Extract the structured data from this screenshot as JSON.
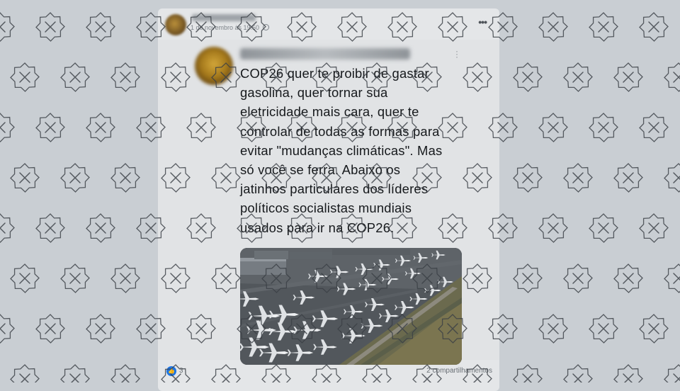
{
  "post": {
    "timestamp": "1 de novembro às 19:50",
    "more_icon": "more-horizontal-icon",
    "privacy_icon": "globe-icon"
  },
  "tweet": {
    "text_lines": [
      "COP26 quer te proibir de gastar",
      "gasolina, quer tornar sua",
      "eletricidade mais cara, quer te",
      "controlar de todas as formas para",
      "evitar \"mudanças climáticas\". Mas",
      "só você se ferra. Abaixo os",
      "jatinhos particulares dos líderes",
      "políticos socialistas mundiais",
      "usados para ir na COP26."
    ]
  },
  "footer": {
    "reaction_count": "3",
    "shares": "2 compartilhamentos",
    "reaction_icon": "like-icon"
  },
  "overlay": {
    "watermark_icon": "x-mark-badge-icon",
    "watermark_color": "#3b4046"
  }
}
